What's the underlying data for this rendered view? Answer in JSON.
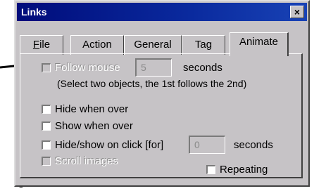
{
  "window": {
    "title": "Links",
    "close_glyph": "×"
  },
  "tabs": [
    {
      "label": "File",
      "underline": "F",
      "rest": "ile"
    },
    {
      "label": "Action"
    },
    {
      "label": "General"
    },
    {
      "label": "Tag"
    },
    {
      "label": "Animate",
      "active": true
    }
  ],
  "animate": {
    "follow": {
      "label": "Follow mouse",
      "value": "5",
      "unit": "seconds",
      "checked": false,
      "enabled": false
    },
    "hint": "(Select two objects, the 1st follows the 2nd)",
    "hide_when_over": {
      "label": "Hide when over",
      "checked": false
    },
    "show_when_over": {
      "label": "Show when over",
      "checked": false
    },
    "hide_show_click": {
      "label": "Hide/show on click [for]",
      "value": "0",
      "unit": "seconds",
      "checked": false
    },
    "scroll_images": {
      "label": "Scroll images",
      "checked": false,
      "enabled": false
    },
    "repeating": {
      "label": "Repeating",
      "checked": false
    }
  },
  "annotations": {
    "stray_char": "s"
  }
}
